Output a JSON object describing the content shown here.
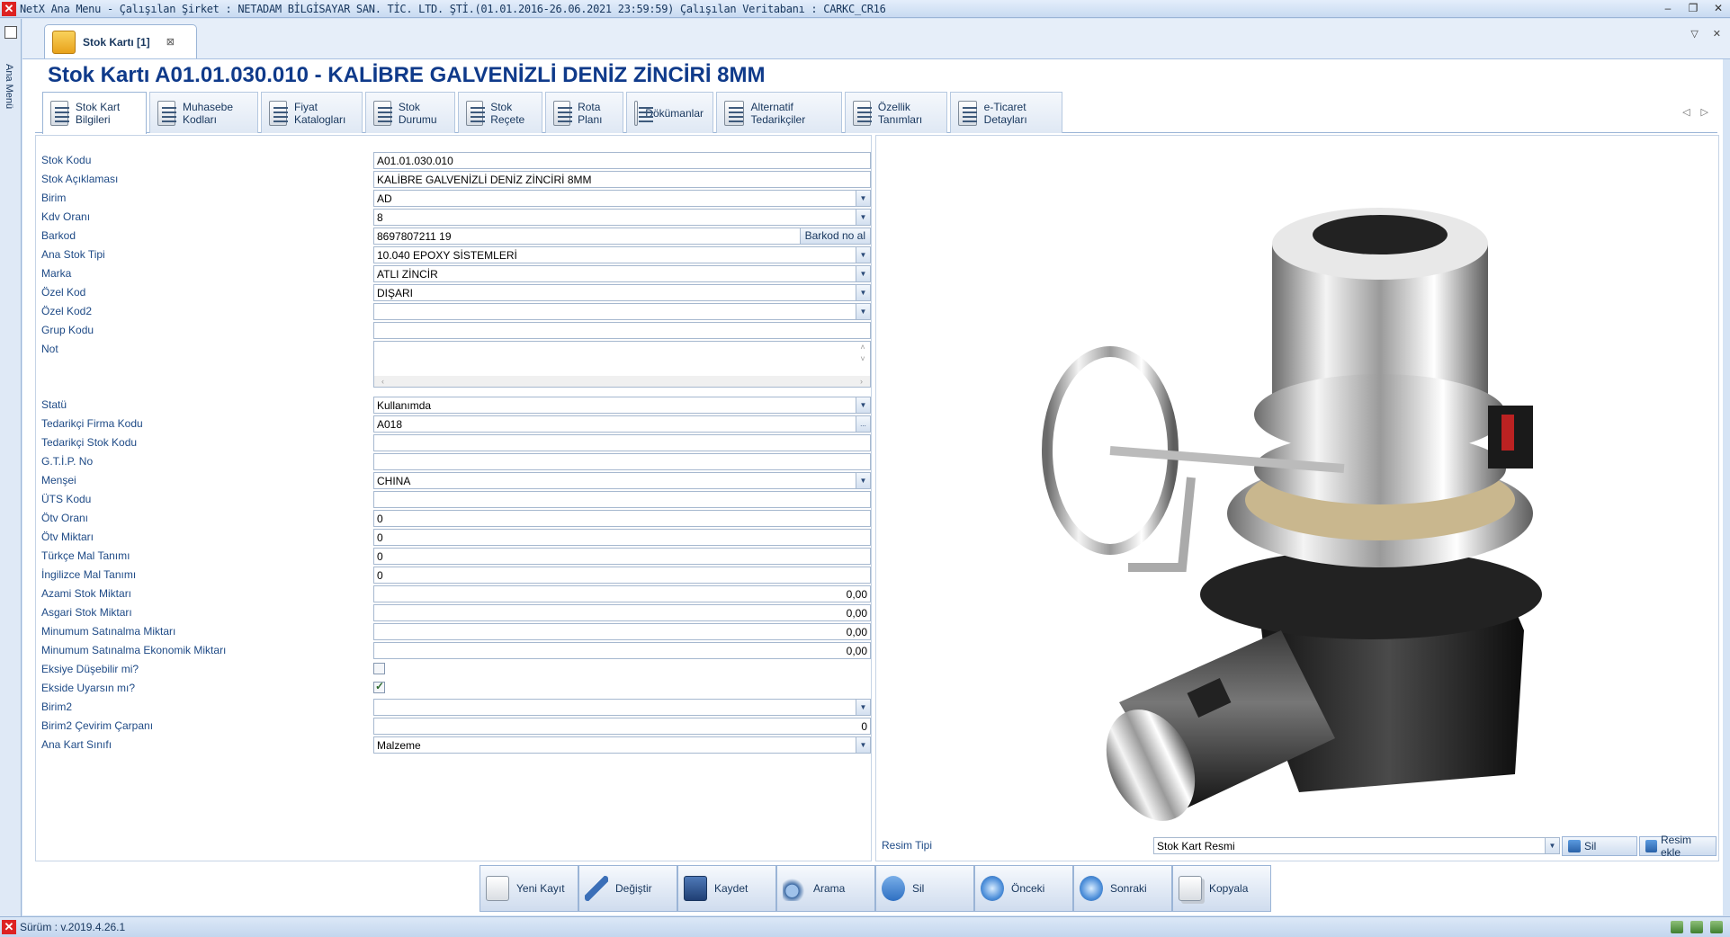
{
  "window": {
    "title": "NetX Ana Menu - Çalışılan Şirket : NETADAM BİLGİSAYAR SAN. TİC. LTD. ŞTİ.(01.01.2016-26.06.2021 23:59:59) Çalışılan Veritabanı : CARKC_CR16",
    "minimize": "–",
    "restore": "❐",
    "close": "✕"
  },
  "sidebar": {
    "label": "Ana Menü"
  },
  "doc_tab": {
    "label": "Stok Kartı [1]",
    "close": "⊠"
  },
  "doc_ctrls": {
    "dropdown": "▽",
    "close": "✕"
  },
  "page": {
    "title": "Stok Kartı  A01.01.030.010 - KALİBRE GALVENİZLİ DENİZ ZİNCİRİ  8MM"
  },
  "subtabs": [
    "Stok Kart Bilgileri",
    "Muhasebe Kodları",
    "Fiyat Katalogları",
    "Stok Durumu",
    "Stok Reçete",
    "Rota Planı",
    "Dökümanlar",
    "Alternatif Tedarikçiler",
    "Özellik Tanımları",
    "e-Ticaret Detayları"
  ],
  "subtab_arrows": {
    "left": "◁",
    "right": "▷"
  },
  "form": {
    "stok_kodu": {
      "label": "Stok Kodu",
      "value": "A01.01.030.010"
    },
    "stok_aciklamasi": {
      "label": "Stok Açıklaması",
      "value": "KALİBRE GALVENİZLİ DENİZ ZİNCİRİ  8MM"
    },
    "birim": {
      "label": "Birim",
      "value": "AD"
    },
    "kdv_orani": {
      "label": "Kdv Oranı",
      "value": "8"
    },
    "barkod": {
      "label": "Barkod",
      "value": "8697807211 19",
      "button": "Barkod no al"
    },
    "ana_stok_tipi": {
      "label": "Ana Stok Tipi",
      "value": "10.040 EPOXY SİSTEMLERİ"
    },
    "marka": {
      "label": "Marka",
      "value": "ATLI ZİNCİR"
    },
    "ozel_kod": {
      "label": "Özel Kod",
      "value": "DIŞARI"
    },
    "ozel_kod2": {
      "label": "Özel Kod2",
      "value": ""
    },
    "grup_kodu": {
      "label": "Grup Kodu",
      "value": ""
    },
    "not": {
      "label": "Not",
      "value": ""
    },
    "statu": {
      "label": "Statü",
      "value": "Kullanımda"
    },
    "tedarikci_firma_kodu": {
      "label": "Tedarikçi Firma Kodu",
      "value": "A018",
      "button": "..."
    },
    "tedarikci_stok_kodu": {
      "label": "Tedarikçi Stok Kodu",
      "value": ""
    },
    "gtip_no": {
      "label": "G.T.İ.P. No",
      "value": ""
    },
    "mensei": {
      "label": "Menşei",
      "value": "CHINA"
    },
    "uts_kodu": {
      "label": "ÜTS Kodu",
      "value": ""
    },
    "otv_orani": {
      "label": "Ötv Oranı",
      "value": "0"
    },
    "otv_miktari": {
      "label": "Ötv Miktarı",
      "value": "0"
    },
    "turkce_mal_tanimi": {
      "label": "Türkçe Mal Tanımı",
      "value": "0"
    },
    "ingilizce_mal_tanimi": {
      "label": "İngilizce Mal Tanımı",
      "value": "0"
    },
    "azami_stok": {
      "label": "Azami Stok Miktarı",
      "value": "0,00"
    },
    "asgari_stok": {
      "label": "Asgari Stok Miktarı",
      "value": "0,00"
    },
    "min_satinalma": {
      "label": "Minumum Satınalma Miktarı",
      "value": "0,00"
    },
    "min_satinalma_ekonomik": {
      "label": "Minumum Satınalma Ekonomik Miktarı",
      "value": "0,00"
    },
    "eksiye_dusebilir": {
      "label": "Eksiye Düşebilir mi?",
      "checked": false
    },
    "ekside_uyarsin": {
      "label": "Ekside Uyarsın mı?",
      "checked": true
    },
    "birim2": {
      "label": "Birim2",
      "value": ""
    },
    "birim2_carpani": {
      "label": "Birim2 Çevirim Çarpanı",
      "value": "0"
    },
    "ana_kart_sinifi": {
      "label": "Ana Kart Sınıfı",
      "value": "Malzeme"
    }
  },
  "image_panel": {
    "label": "Resim Tipi",
    "value": "Stok Kart Resmi",
    "delete_button": "Sil",
    "add_button": "Resim ekle"
  },
  "actions": [
    "Yeni Kayıt",
    "Değiştir",
    "Kaydet",
    "Arama",
    "Sil",
    "Önceki",
    "Sonraki",
    "Kopyala"
  ],
  "status": {
    "version": "Sürüm : v.2019.4.26.1"
  }
}
